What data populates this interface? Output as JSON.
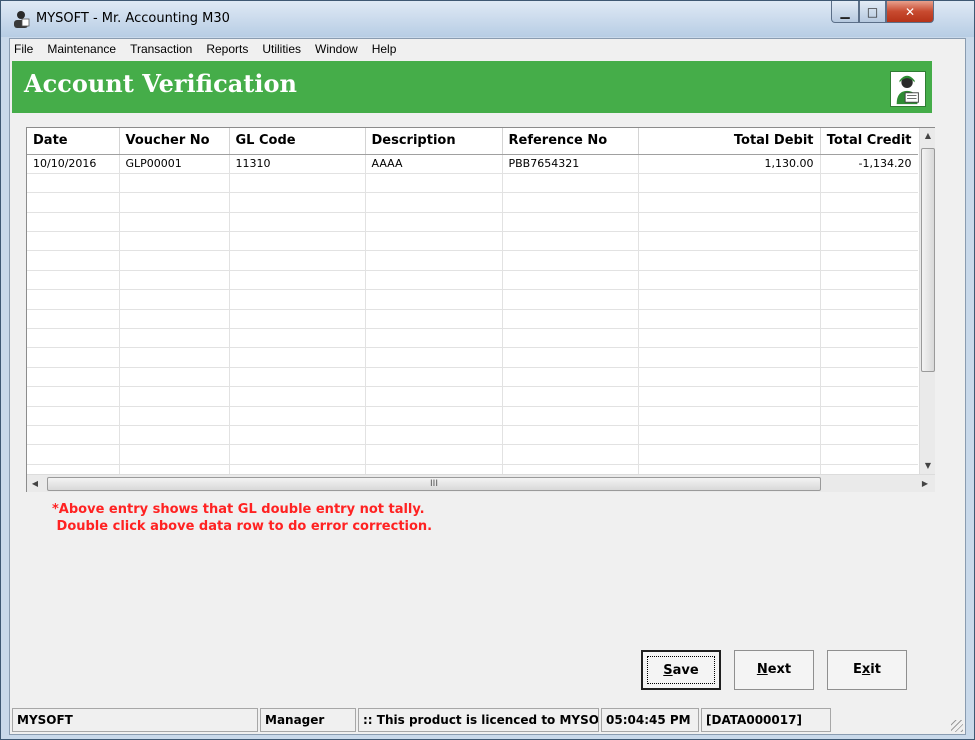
{
  "window": {
    "title": "MYSOFT - Mr. Accounting M30"
  },
  "menu": [
    "File",
    "Maintenance",
    "Transaction",
    "Reports",
    "Utilities",
    "Window",
    "Help"
  ],
  "banner": {
    "heading": "Account Verification",
    "accent": "#45ad49"
  },
  "grid": {
    "columns": [
      "Date",
      "Voucher No",
      "GL Code",
      "Description",
      "Reference No",
      "Total Debit",
      "Total Credit"
    ],
    "rows": [
      {
        "date": "10/10/2016",
        "voucher_no": "GLP00001",
        "gl_code": "11310",
        "description": "AAAA",
        "reference_no": "PBB7654321",
        "total_debit": "1,130.00",
        "total_credit": "-1,134.20"
      }
    ],
    "hscroll_grip": "III"
  },
  "notice": {
    "line1": "*Above entry shows that GL double entry not tally.",
    "line2": " Double click above data row to do error correction.",
    "color": "#ff2222"
  },
  "buttons": {
    "save": {
      "mnemonic": "S",
      "rest": "ave"
    },
    "next": {
      "mnemonic": "N",
      "rest": "ext"
    },
    "exit": {
      "pre": "E",
      "mnemonic": "x",
      "rest": "it"
    }
  },
  "status": {
    "company": "MYSOFT",
    "user": "Manager",
    "licence": ":: This product is licenced to MYSOFT",
    "time": "05:04:45 PM",
    "dataset": "[DATA000017]"
  }
}
